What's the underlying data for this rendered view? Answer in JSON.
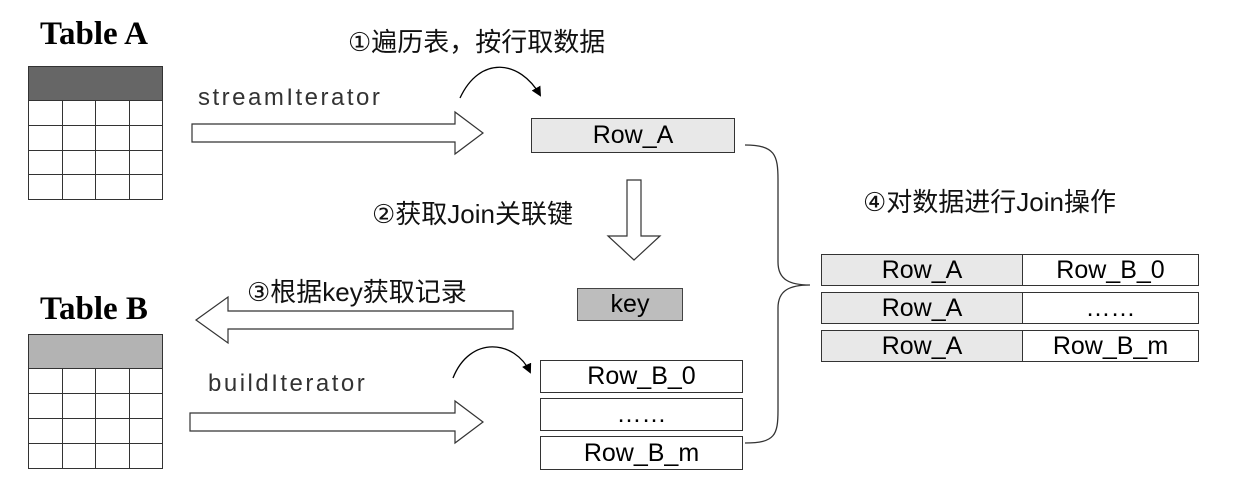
{
  "table_a": {
    "title": "Table A",
    "rows": 5,
    "cols": 4
  },
  "table_b": {
    "title": "Table B",
    "rows": 5,
    "cols": 4
  },
  "steps": {
    "s1": "①遍历表，按行取数据",
    "s2": "②获取Join关联键",
    "s3": "③根据key获取记录",
    "s4": "④对数据进行Join操作"
  },
  "iterators": {
    "stream": "streamIterator",
    "build": "buildIterator"
  },
  "rows": {
    "row_a": "Row_A",
    "key": "key",
    "row_b_0": "Row_B_0",
    "row_b_ellipsis": "……",
    "row_b_m": "Row_B_m"
  },
  "result": [
    {
      "left": "Row_A",
      "right": "Row_B_0"
    },
    {
      "left": "Row_A",
      "right": "……"
    },
    {
      "left": "Row_A",
      "right": "Row_B_m"
    }
  ],
  "colors": {
    "header_a": "#666666",
    "header_b": "#b3b3b3",
    "row_fill": "#e8e8e8",
    "key_fill": "#bdbdbd"
  }
}
